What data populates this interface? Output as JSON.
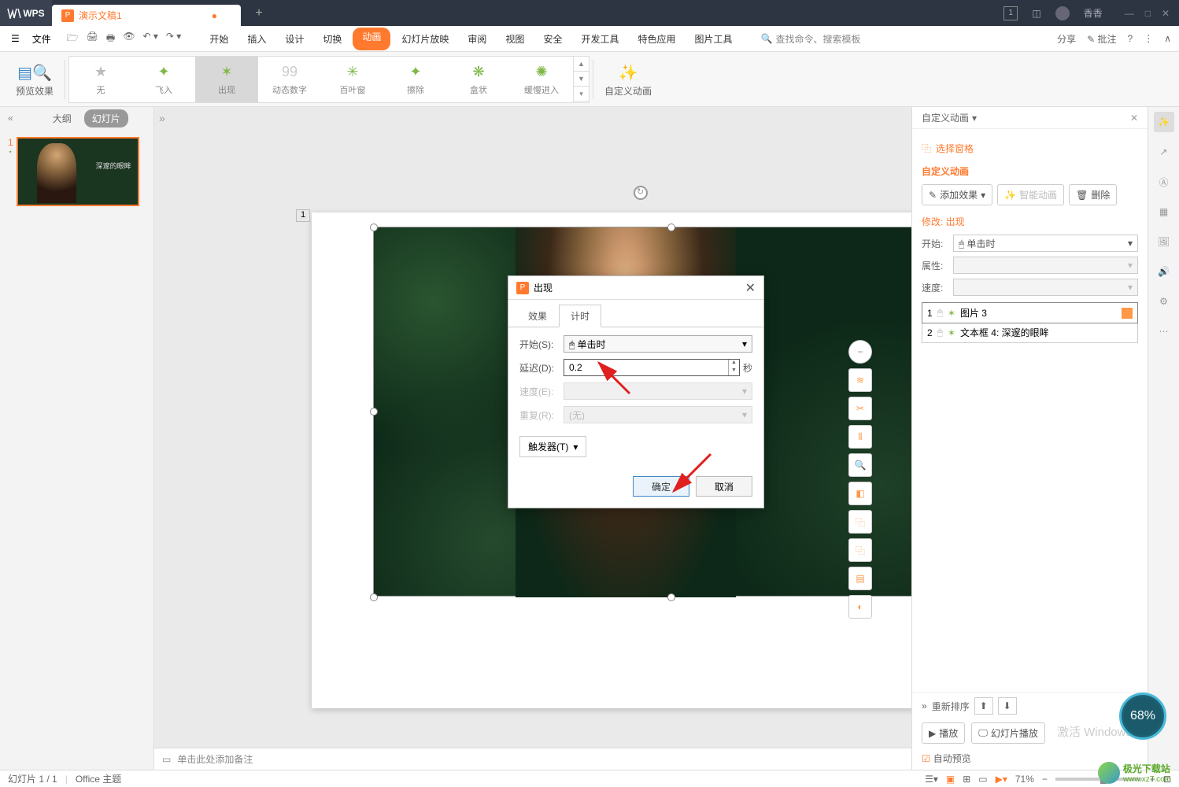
{
  "titlebar": {
    "logo": "WPS",
    "doc_name": "演示文稿1",
    "user": "香香",
    "badge": "1"
  },
  "menubar": {
    "file": "文件",
    "tabs": [
      "开始",
      "插入",
      "设计",
      "切换",
      "动画",
      "幻灯片放映",
      "审阅",
      "视图",
      "安全",
      "开发工具",
      "特色应用",
      "图片工具"
    ],
    "active_index": 4,
    "search": "查找命令、搜索模板",
    "share": "分享",
    "annotate": "批注"
  },
  "ribbon": {
    "preview": "预览效果",
    "items": [
      "无",
      "飞入",
      "出现",
      "动态数字",
      "百叶窗",
      "擦除",
      "盒状",
      "缓慢进入"
    ],
    "active_index": 2,
    "custom": "自定义动画"
  },
  "left_panel": {
    "outline": "大纲",
    "slides": "幻灯片",
    "slide_num": "1"
  },
  "canvas": {
    "sel_num": "1",
    "notes_placeholder": "单击此处添加备注"
  },
  "right_panel": {
    "title": "自定义动画",
    "select_pane": "选择窗格",
    "section": "自定义动画",
    "add_effect": "添加效果",
    "smart": "智能动画",
    "delete": "删除",
    "modify": "修改: 出现",
    "start_label": "开始:",
    "start_value": "单击时",
    "attr_label": "属性:",
    "speed_label": "速度:",
    "items": [
      {
        "num": "1",
        "label": "图片 3",
        "selected": true
      },
      {
        "num": "2",
        "label": "文本框 4: 深邃的眼眸",
        "selected": false
      }
    ],
    "reorder": "重新排序",
    "play": "播放",
    "slideshow": "幻灯片播放",
    "auto_preview": "自动预览"
  },
  "dialog": {
    "title": "出现",
    "tab_effect": "效果",
    "tab_timing": "计时",
    "start_label": "开始(S):",
    "start_value": "单击时",
    "delay_label": "延迟(D):",
    "delay_value": "0.2",
    "delay_suffix": "秒",
    "speed_label": "速度(E):",
    "repeat_label": "重复(R):",
    "repeat_value": "(无)",
    "trigger": "触发器(T)",
    "ok": "确定",
    "cancel": "取消"
  },
  "statusbar": {
    "slide_info": "幻灯片 1 / 1",
    "theme": "Office 主题",
    "zoom": "71%"
  },
  "watermark": {
    "line1": "激活 Windows"
  },
  "badge": "68%",
  "logo": {
    "name": "极光下载站",
    "url": "www.xz7.com"
  }
}
